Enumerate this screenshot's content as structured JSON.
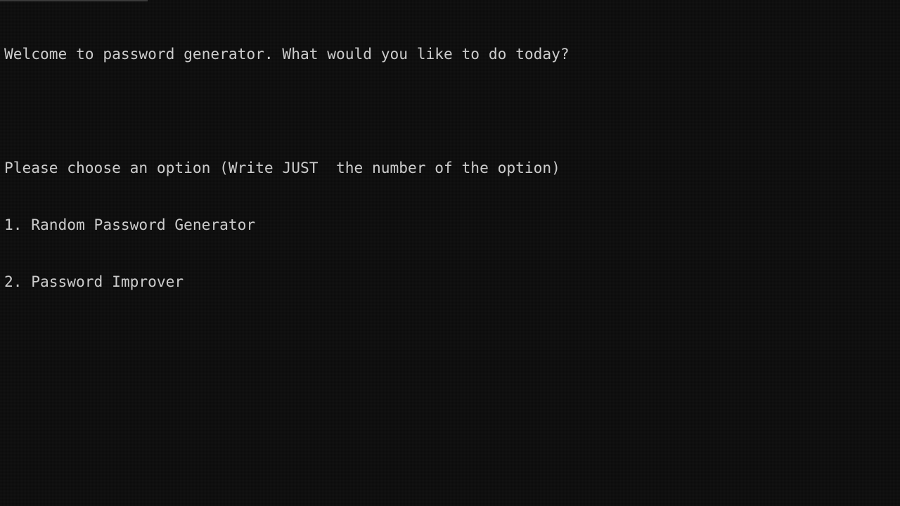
{
  "terminal": {
    "lines": [
      "Welcome to password generator. What would you like to do today?",
      "",
      "Please choose an option (Write JUST  the number of the option)",
      "1. Random Password Generator",
      "2. Password Improver"
    ],
    "colors": {
      "background": "#0c0c0c",
      "foreground": "#cccccc"
    }
  }
}
